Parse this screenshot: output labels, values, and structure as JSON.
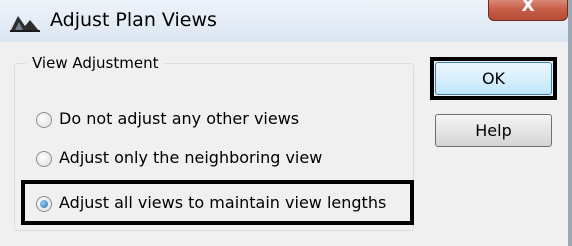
{
  "window": {
    "title": "Adjust Plan Views",
    "icon": "application-icon",
    "close_label": "X"
  },
  "group": {
    "legend": "View Adjustment",
    "options": [
      {
        "label": "Do not adjust any other views",
        "checked": false
      },
      {
        "label": "Adjust only the neighboring view",
        "checked": false
      },
      {
        "label": "Adjust all views to maintain view lengths",
        "checked": true
      }
    ]
  },
  "buttons": {
    "ok_label": "OK",
    "help_label": "Help"
  },
  "colors": {
    "highlight_border": "#000000",
    "dialog_background": "#f0f0f0",
    "close_button": "#c9604a"
  }
}
